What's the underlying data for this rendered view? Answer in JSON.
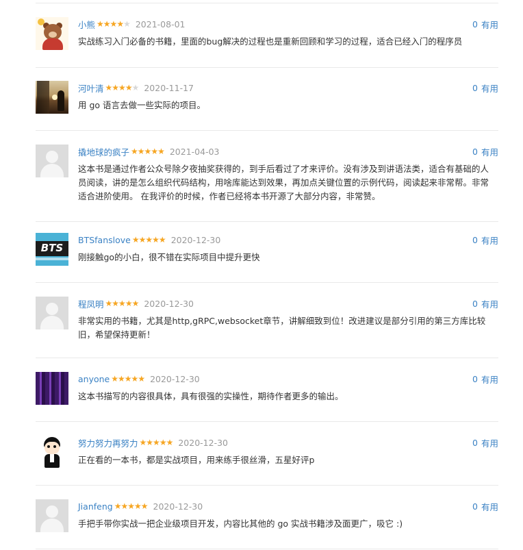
{
  "useful_label": "有用",
  "star_glyph": "★",
  "colors": {
    "username": "#3b82c4",
    "star_on": "#f6a623",
    "star_off": "#d8d8d8",
    "date": "#999999",
    "text": "#333333",
    "divider": "#e9e9e9"
  },
  "reviews": [
    {
      "username": "小熊",
      "rating": 4,
      "date": "2021-08-01",
      "useful_count": "0",
      "avatar": "bear-avatar",
      "content": "实战练习入门必备的书籍，里面的bug解决的过程也是重新回顾和学习的过程，适合已经入门的程序员"
    },
    {
      "username": "河叶清",
      "rating": 4,
      "date": "2020-11-17",
      "useful_count": "0",
      "avatar": "lake-photo-avatar",
      "content": "用 go 语言去做一些实际的项目。"
    },
    {
      "username": "撬地球的疯子",
      "rating": 5,
      "date": "2021-04-03",
      "useful_count": "0",
      "avatar": "default-avatar",
      "content": "这本书是通过作者公众号除夕夜抽奖获得的，到手后看过了才来评价。没有涉及到讲语法类，适合有基础的人员阅读，讲的是怎么组织代码结构，用啥库能达到效果，再加点关键位置的示例代码，阅读起来非常帮。非常适合进阶使用。 在我评价的时候，作者已经将本书开源了大部分内容，非常赞。"
    },
    {
      "username": "BTSfanslove",
      "rating": 5,
      "date": "2020-12-30",
      "useful_count": "0",
      "avatar": "bts-avatar",
      "content": "刚接触go的小白，很不错在实际项目中提升更快"
    },
    {
      "username": "程凤明",
      "rating": 5,
      "date": "2020-12-30",
      "useful_count": "0",
      "avatar": "default-avatar",
      "content": "非常实用的书籍，尤其是http,gRPC,websocket章节，讲解细致到位！改进建议是部分引用的第三方库比较旧，希望保持更新！"
    },
    {
      "username": "anyone",
      "rating": 5,
      "date": "2020-12-30",
      "useful_count": "0",
      "avatar": "purple-avatar",
      "content": "这本书描写的内容很具体，具有很强的实操性，期待作者更多的输出。"
    },
    {
      "username": "努力努力再努力",
      "rating": 5,
      "date": "2020-12-30",
      "useful_count": "0",
      "avatar": "cartoon-avatar",
      "content": "正在看的一本书，都是实战项目，用来练手很丝滑，五星好评p"
    },
    {
      "username": "Jianfeng",
      "rating": 5,
      "date": "2020-12-30",
      "useful_count": "0",
      "avatar": "default-avatar",
      "content": "手把手带你实战一把企业级项目开发，内容比其他的 go 实战书籍涉及面更广，吸它 :)"
    }
  ]
}
